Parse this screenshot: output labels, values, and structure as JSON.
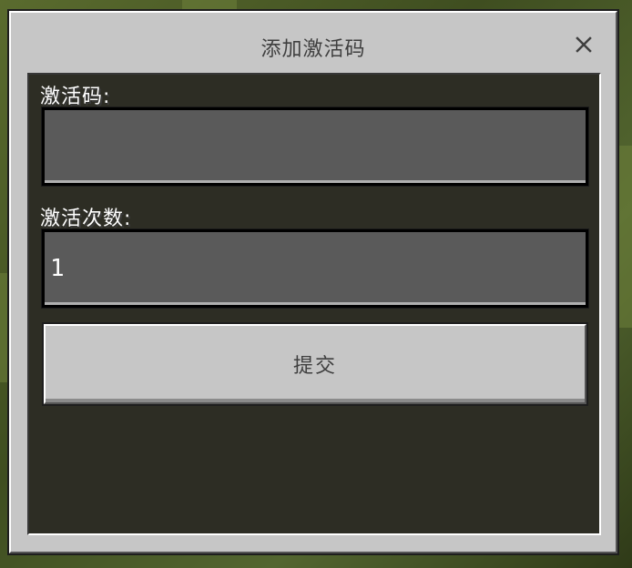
{
  "dialog": {
    "title": "添加激活码",
    "close_icon": "close-icon"
  },
  "form": {
    "code_label": "激活码:",
    "code_value": "",
    "count_label": "激活次数:",
    "count_value": "1",
    "submit_label": "提交"
  },
  "colors": {
    "panel": "#c6c6c6",
    "field_bg": "#5a5a5a",
    "body_bg": "#18180e",
    "text_dark": "#3f3f3f",
    "text_light": "#ffffff"
  }
}
